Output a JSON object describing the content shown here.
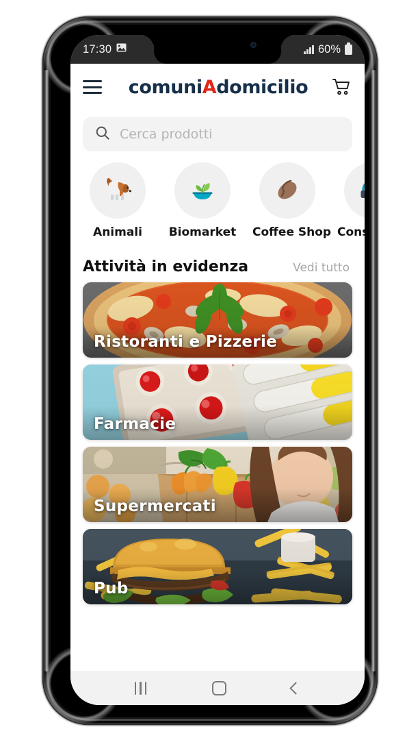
{
  "status_bar": {
    "time": "17:30",
    "battery_percent": "60%",
    "screenshot_icon": "image-icon",
    "signal_icon": "signal-bars-icon",
    "battery_icon": "battery-icon"
  },
  "header": {
    "menu_icon": "hamburger-menu-icon",
    "logo_part1": "comuni",
    "logo_accent": "A",
    "logo_part2": "domicilio",
    "cart_icon": "shopping-cart-icon",
    "logo_color": "#17304a",
    "accent_color": "#e02718"
  },
  "search": {
    "placeholder": "Cerca prodotti",
    "value": "",
    "icon": "search-icon"
  },
  "categories": [
    {
      "label": "Animali",
      "icon": "dog-icon"
    },
    {
      "label": "Biomarket",
      "icon": "plant-bowl-icon"
    },
    {
      "label": "Coffee Shop",
      "icon": "coffee-bean-icon"
    },
    {
      "label": "Consulenza",
      "icon": "headset-icon"
    }
  ],
  "section": {
    "title": "Attività in evidenza",
    "link": "Vedi tutto"
  },
  "cards": [
    {
      "title": "Ristoranti e Pizzerie",
      "image": "pizza-photo"
    },
    {
      "title": "Farmacie",
      "image": "pills-blister-photo"
    },
    {
      "title": "Supermercati",
      "image": "grocery-bag-photo"
    },
    {
      "title": "Pub",
      "image": "burger-fries-photo"
    }
  ],
  "navbar": {
    "recents": "recents-icon",
    "home": "home-icon",
    "back": "back-icon"
  }
}
